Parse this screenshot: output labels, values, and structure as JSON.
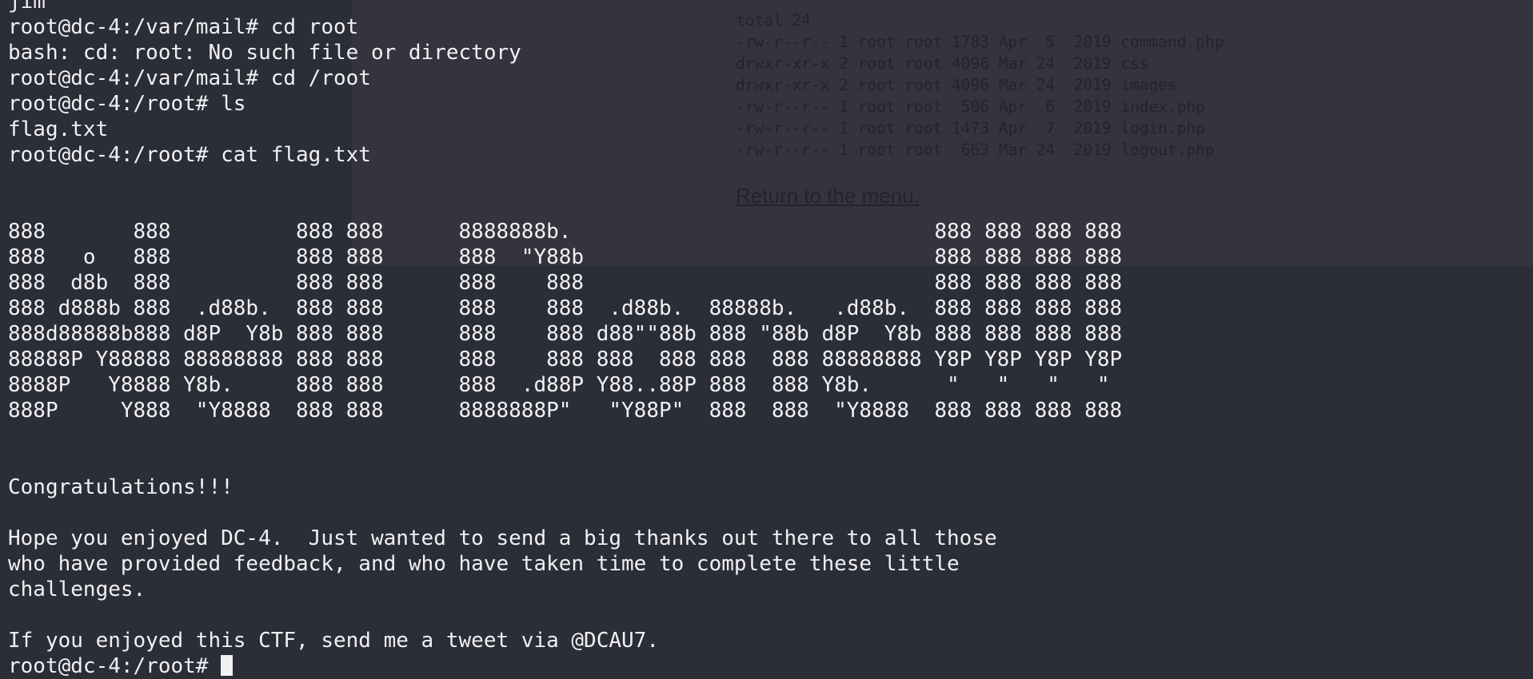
{
  "background_page": {
    "listing": [
      "total 24",
      "-rw-r--r-- 1 root root 1783 Apr  5  2019 command.php",
      "drwxr-xr-x 2 root root 4096 Mar 24  2019 css",
      "drwxr-xr-x 2 root root 4096 Mar 24  2019 images",
      "-rw-r--r-- 1 root root  506 Apr  6  2019 index.php",
      "-rw-r--r-- 1 root root 1473 Apr  7  2019 login.php",
      "-rw-r--r-- 1 root root  663 Mar 24  2019 logout.php"
    ],
    "return_link": "Return to the menu."
  },
  "terminal": {
    "lines": [
      "jim",
      "root@dc-4:/var/mail# cd root",
      "bash: cd: root: No such file or directory",
      "root@dc-4:/var/mail# cd /root",
      "root@dc-4:/root# ls",
      "flag.txt",
      "root@dc-4:/root# cat flag.txt",
      "",
      "",
      "888       888          888 888      8888888b.                             888 888 888 888",
      "888   o   888          888 888      888  \"Y88b                            888 888 888 888",
      "888  d8b  888          888 888      888    888                            888 888 888 888",
      "888 d888b 888  .d88b.  888 888      888    888  .d88b.  88888b.   .d88b.  888 888 888 888",
      "888d88888b888 d8P  Y8b 888 888      888    888 d88\"\"88b 888 \"88b d8P  Y8b 888 888 888 888",
      "88888P Y88888 88888888 888 888      888    888 888  888 888  888 88888888 Y8P Y8P Y8P Y8P",
      "8888P   Y8888 Y8b.     888 888      888  .d88P Y88..88P 888  888 Y8b.      \"   \"   \"   \"",
      "888P     Y888  \"Y8888  888 888      8888888P\"   \"Y88P\"  888  888  \"Y8888  888 888 888 888",
      "",
      "",
      "Congratulations!!!",
      "",
      "Hope you enjoyed DC-4.  Just wanted to send a big thanks out there to all those",
      "who have provided feedback, and who have taken time to complete these little",
      "challenges.",
      "",
      "If you enjoyed this CTF, send me a tweet via @DCAU7."
    ],
    "prompt": "root@dc-4:/root# "
  }
}
